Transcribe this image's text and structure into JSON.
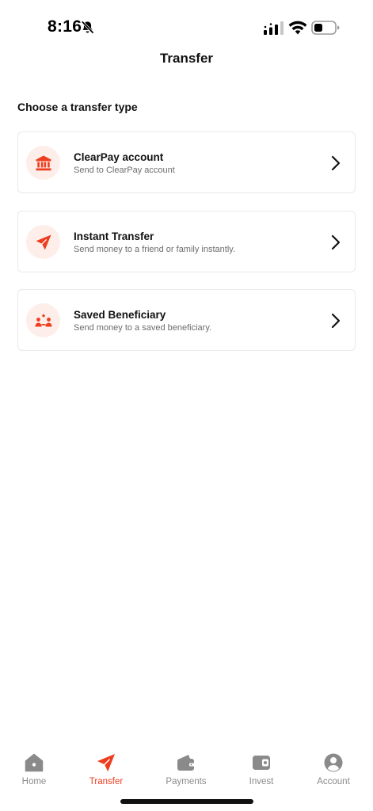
{
  "status_bar": {
    "time": "8:16",
    "icons": [
      "bell-slash-icon",
      "signal-icon",
      "wifi-icon",
      "battery-icon"
    ]
  },
  "header": {
    "title": "Transfer"
  },
  "section": {
    "title": "Choose a transfer type"
  },
  "options": [
    {
      "icon": "bank-icon",
      "title": "ClearPay account",
      "subtitle": "Send to ClearPay account"
    },
    {
      "icon": "paper-plane-icon",
      "title": "Instant Transfer",
      "subtitle": "Send money to a friend or family instantly."
    },
    {
      "icon": "beneficiary-icon",
      "title": "Saved Beneficiary",
      "subtitle": "Send money to a saved beneficiary."
    }
  ],
  "bottom_nav": {
    "items": [
      {
        "label": "Home",
        "icon": "home-icon",
        "active": false
      },
      {
        "label": "Transfer",
        "icon": "paper-plane-icon",
        "active": true
      },
      {
        "label": "Payments",
        "icon": "payments-icon",
        "active": false
      },
      {
        "label": "Invest",
        "icon": "wallet-icon",
        "active": false
      },
      {
        "label": "Account",
        "icon": "user-icon",
        "active": false
      }
    ]
  },
  "colors": {
    "accent": "#ee3d1e",
    "icon_bg": "#fdeeea",
    "card_border": "#e9e9e9",
    "nav_inactive": "#8a8a8a",
    "text_secondary": "#6d6d6d"
  }
}
